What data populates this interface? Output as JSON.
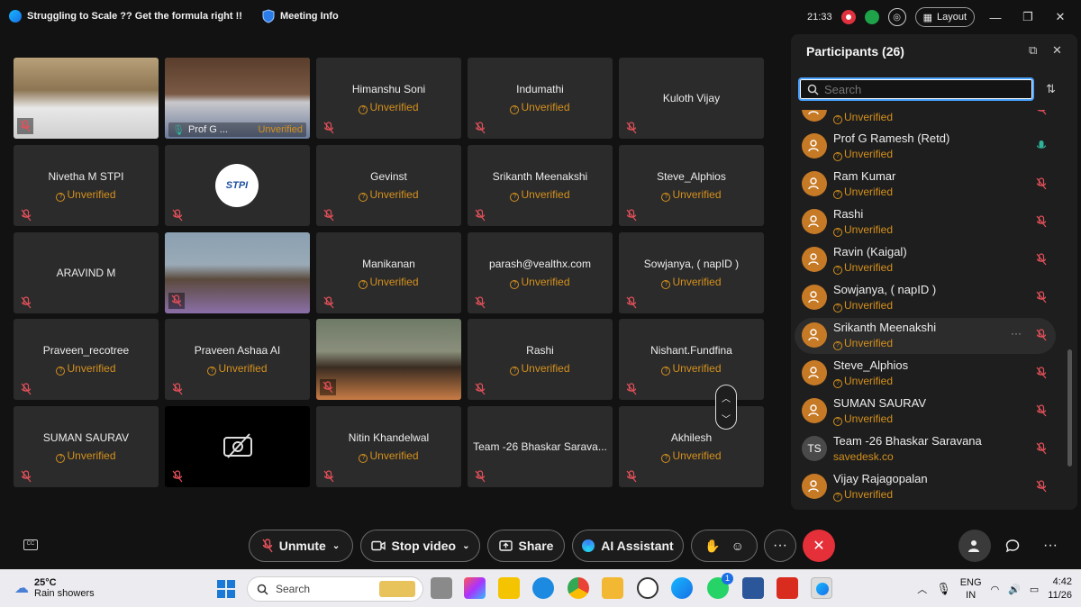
{
  "window": {
    "meeting_title": "Struggling to Scale ?? Get the formula right !!",
    "meeting_info": "Meeting Info",
    "time": "21:33",
    "layout_label": "Layout"
  },
  "tiles": [
    {
      "type": "video",
      "label": ""
    },
    {
      "type": "video",
      "label": "Prof G ...",
      "status": "Unverified",
      "active": true
    },
    {
      "type": "name",
      "name": "Himanshu Soni",
      "status": "Unverified"
    },
    {
      "type": "name",
      "name": "Indumathi",
      "status": "Unverified"
    },
    {
      "type": "name",
      "name": "Kuloth Vijay",
      "status": ""
    },
    {
      "type": "name",
      "name": "Nivetha M STPI",
      "status": "Unverified"
    },
    {
      "type": "logo",
      "name": "STPI"
    },
    {
      "type": "name",
      "name": "Gevinst",
      "status": "Unverified"
    },
    {
      "type": "name",
      "name": "Srikanth Meenakshi",
      "status": "Unverified"
    },
    {
      "type": "name",
      "name": "Steve_Alphios",
      "status": "Unverified"
    },
    {
      "type": "name",
      "name": "ARAVIND M",
      "status": ""
    },
    {
      "type": "video",
      "label": ""
    },
    {
      "type": "name",
      "name": "Manikanan",
      "status": "Unverified"
    },
    {
      "type": "name",
      "name": "parash@vealthx.com",
      "status": "Unverified"
    },
    {
      "type": "name",
      "name": "Sowjanya, ( napID )",
      "status": "Unverified"
    },
    {
      "type": "name",
      "name": "Praveen_recotree",
      "status": "Unverified"
    },
    {
      "type": "name",
      "name": "Praveen Ashaa AI",
      "status": "Unverified"
    },
    {
      "type": "video",
      "label": ""
    },
    {
      "type": "name",
      "name": "Rashi",
      "status": "Unverified"
    },
    {
      "type": "name",
      "name": "Nishant.Fundfina",
      "status": "Unverified"
    },
    {
      "type": "name",
      "name": "SUMAN SAURAV",
      "status": "Unverified"
    },
    {
      "type": "novideo",
      "name": ""
    },
    {
      "type": "name",
      "name": "Nitin Khandelwal",
      "status": "Unverified"
    },
    {
      "type": "name",
      "name": "Team -26 Bhaskar Sarava...",
      "status": ""
    },
    {
      "type": "name",
      "name": "Akhilesh",
      "status": "Unverified"
    }
  ],
  "panel": {
    "title": "Participants (26)",
    "search_placeholder": "Search",
    "participants": [
      {
        "name": "",
        "sub": "Unverified",
        "mic": "muted",
        "avatar": "person"
      },
      {
        "name": "Prof G Ramesh  (Retd)",
        "sub": "Unverified",
        "mic": "active",
        "avatar": "person"
      },
      {
        "name": "Ram Kumar",
        "sub": "Unverified",
        "mic": "muted",
        "avatar": "person"
      },
      {
        "name": "Rashi",
        "sub": "Unverified",
        "mic": "muted",
        "avatar": "person"
      },
      {
        "name": "Ravin (Kaigal)",
        "sub": "Unverified",
        "mic": "muted",
        "avatar": "person"
      },
      {
        "name": "Sowjanya, ( napID )",
        "sub": "Unverified",
        "mic": "muted",
        "avatar": "person"
      },
      {
        "name": "Srikanth Meenakshi",
        "sub": "Unverified",
        "mic": "muted",
        "avatar": "person",
        "highlight": true
      },
      {
        "name": "Steve_Alphios",
        "sub": "Unverified",
        "mic": "muted",
        "avatar": "person"
      },
      {
        "name": "SUMAN SAURAV",
        "sub": "Unverified",
        "mic": "muted",
        "avatar": "person"
      },
      {
        "name": "Team -26 Bhaskar Saravana",
        "sub": "savedesk.co",
        "mic": "muted",
        "avatar": "TS"
      },
      {
        "name": "Vijay Rajagopalan",
        "sub": "Unverified",
        "mic": "muted",
        "avatar": "person"
      }
    ]
  },
  "controls": {
    "unmute": "Unmute",
    "stop_video": "Stop video",
    "share": "Share",
    "ai_assistant": "AI Assistant"
  },
  "taskbar": {
    "temp": "25°C",
    "weather": "Rain showers",
    "search_placeholder": "Search",
    "lang_top": "ENG",
    "lang_bottom": "IN",
    "clock_time": "4:42",
    "clock_date": "11/26",
    "whatsapp_badge": "1"
  },
  "colors": {
    "unverified": "#d4901d",
    "active_border": "#2fb39a",
    "end_call": "#e5303a",
    "search_focus": "#4aa3ff"
  }
}
